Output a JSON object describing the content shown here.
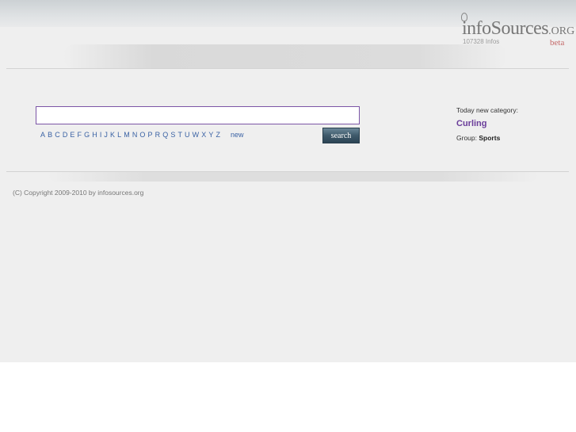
{
  "logo": {
    "brand_main": "infoSources",
    "brand_suffix": ".ORG",
    "count_text": "107328  Infos",
    "beta_label": "beta"
  },
  "search": {
    "value": "",
    "placeholder": "",
    "button_label": "search"
  },
  "alphabet": {
    "letters": [
      "A",
      "B",
      "C",
      "D",
      "E",
      "F",
      "G",
      "H",
      "I",
      "J",
      "K",
      "L",
      "M",
      "N",
      "O",
      "P",
      "R",
      "Q",
      "S",
      "T",
      "U",
      "W",
      "X",
      "Y",
      "Z"
    ],
    "new_label": "new"
  },
  "today": {
    "label": "Today new category:",
    "category": "Curling",
    "group_label": "Group:",
    "group_value": "Sports"
  },
  "footer": {
    "copyright": "(C) Copyright 2009-2010 by infosources.org"
  },
  "colors": {
    "link": "#3a62a4",
    "category": "#6a3d9a",
    "input_border": "#7b55a6",
    "beta": "#c56a6a"
  }
}
